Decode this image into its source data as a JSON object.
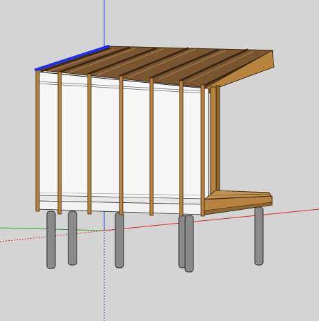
{
  "viewport": {
    "background": "#d4d4d4",
    "selected_edge_color": "#1f2fe6"
  },
  "axes": {
    "red": "#d52a2a",
    "green": "#2aa52a",
    "blue": "#2f3fe0"
  },
  "colors": {
    "wall_face": "#f7f7f7",
    "stud": "#b7843f",
    "stud_edge": "#3d2a12",
    "roof_joist": "#6a4a25",
    "roof_dark": "#3b2612",
    "post": "#8a8a8a",
    "post_edge": "#2a2a2a"
  }
}
